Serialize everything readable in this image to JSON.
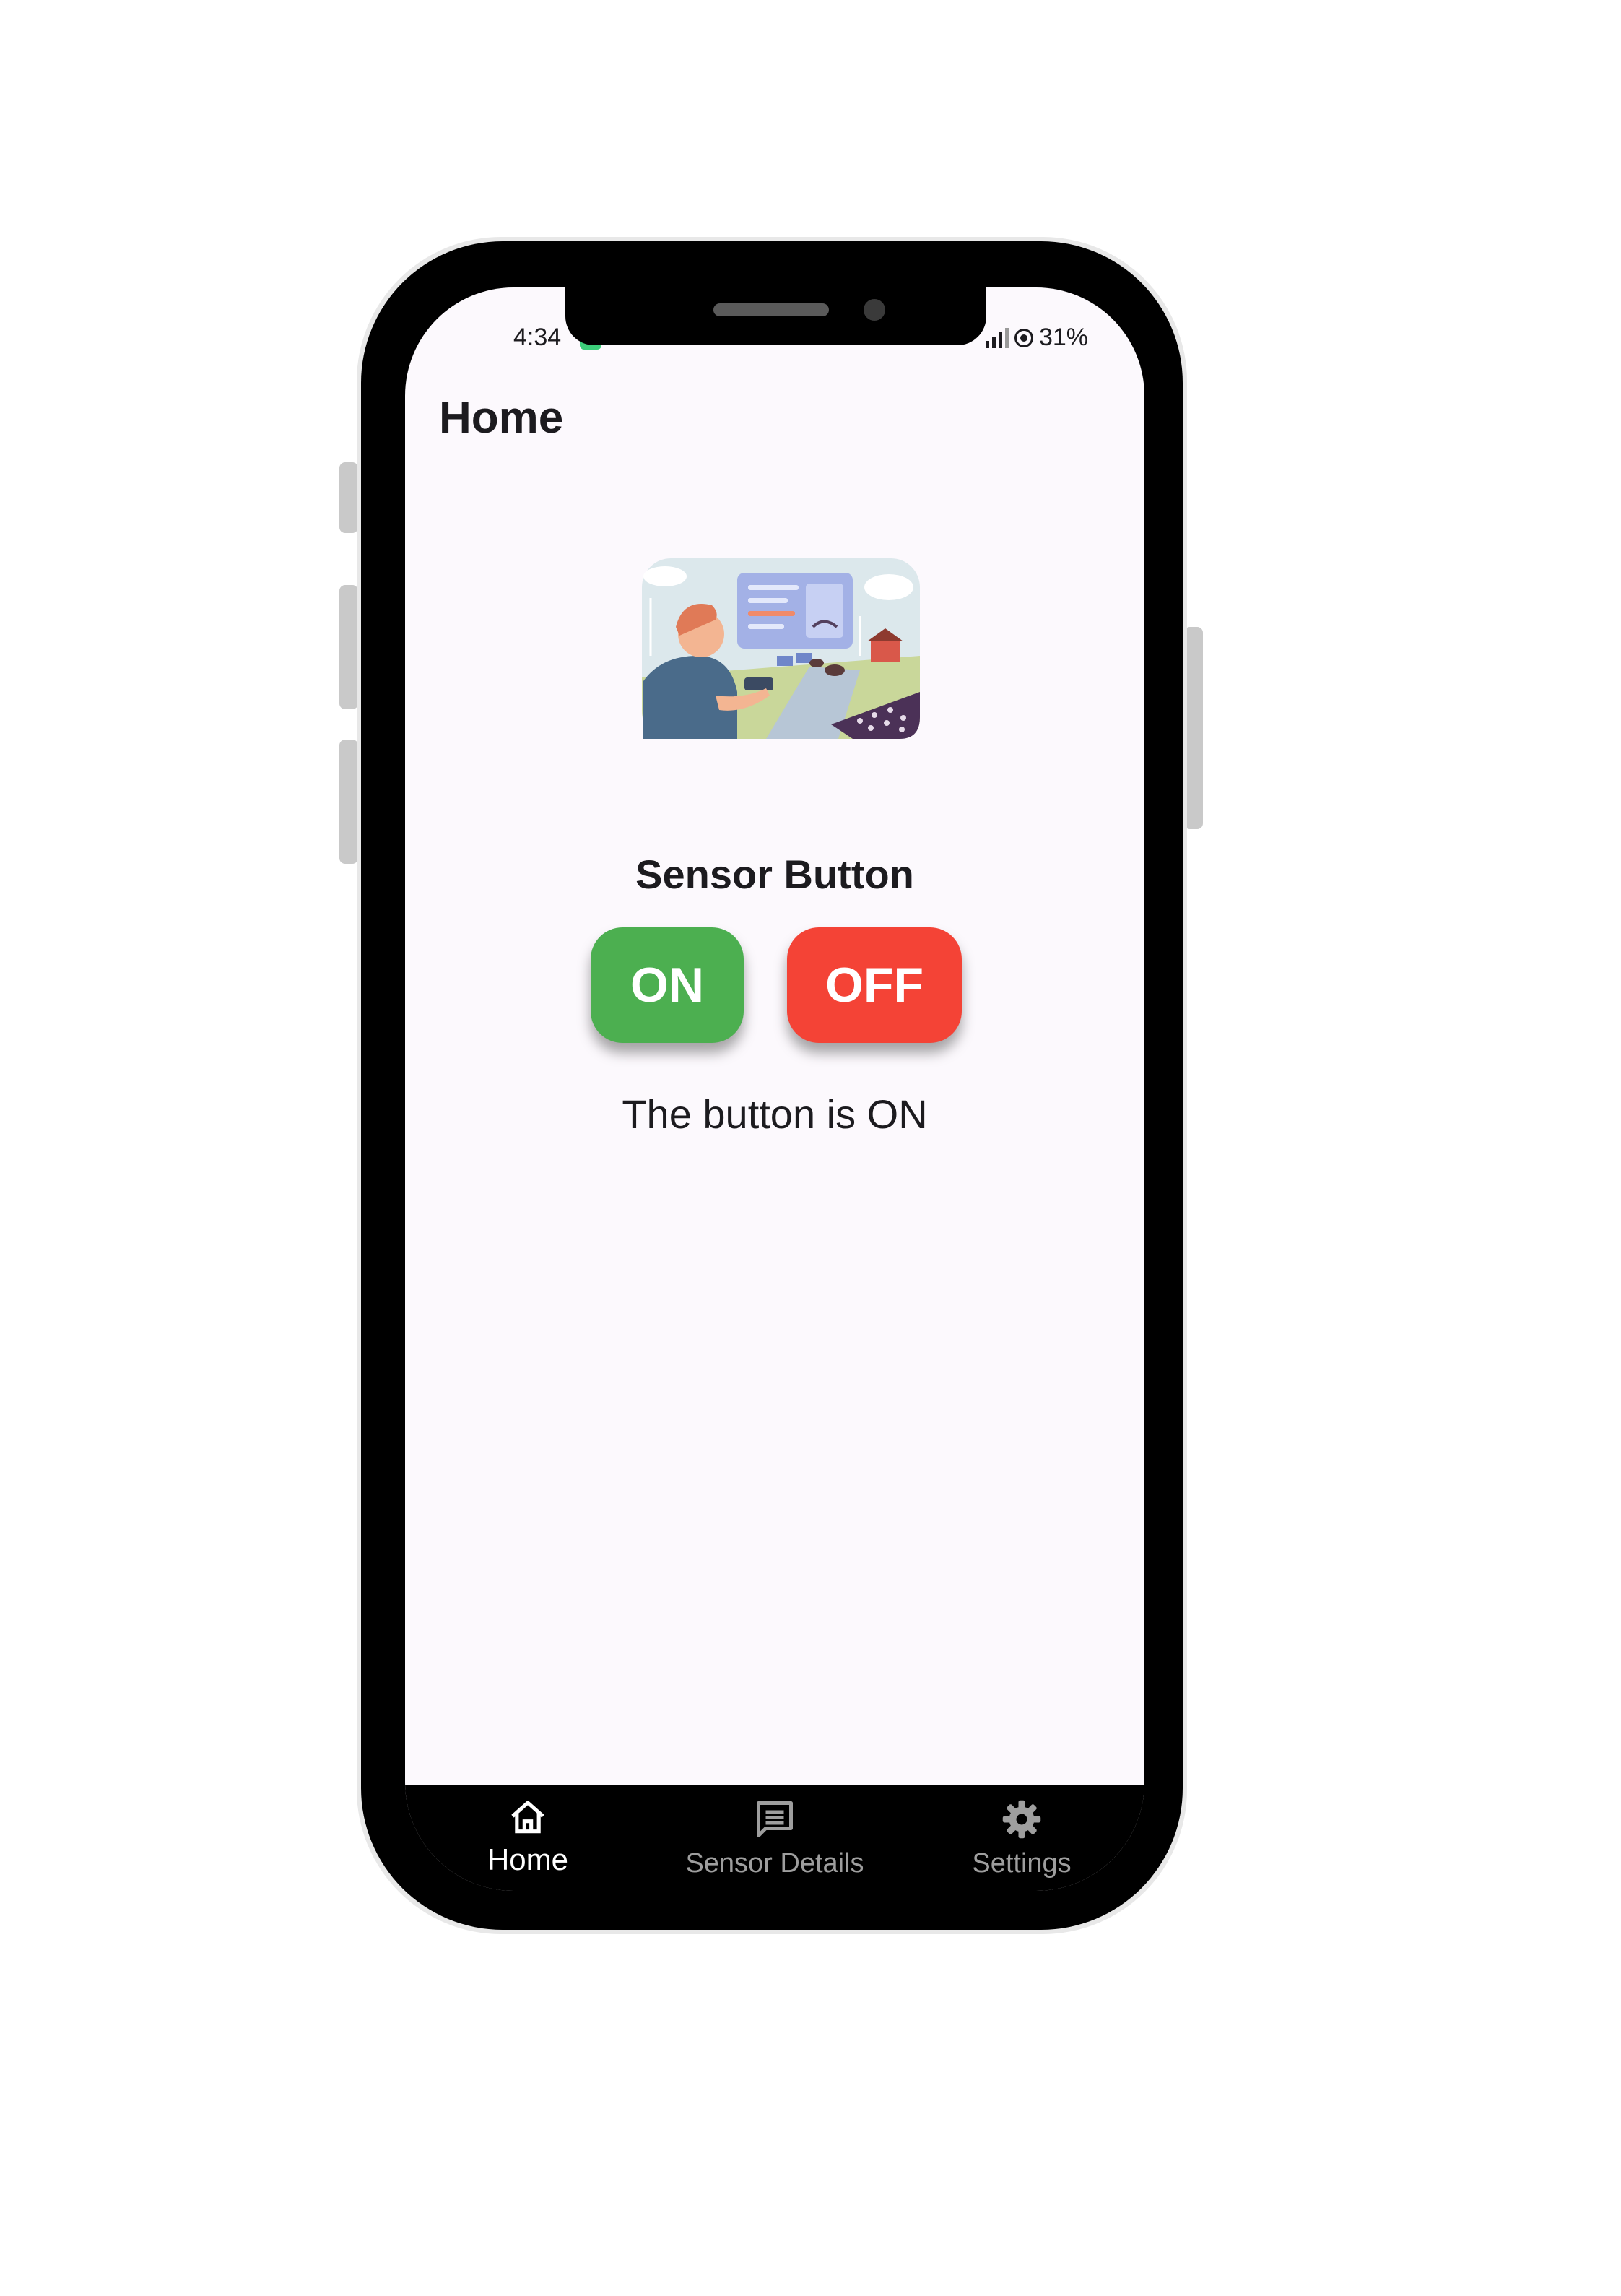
{
  "status_bar": {
    "time": "4:34",
    "battery": "31%"
  },
  "app_bar": {
    "title": "Home"
  },
  "main": {
    "illustration": "farmer-with-smart-farm-dashboard-illustration",
    "section_title": "Sensor Button",
    "on_label": "ON",
    "off_label": "OFF",
    "status_message": "The button is ON"
  },
  "bottom_nav": {
    "items": [
      {
        "label": "Home",
        "icon": "home-icon",
        "active": true
      },
      {
        "label": "Sensor Details",
        "icon": "message-icon",
        "active": false
      },
      {
        "label": "Settings",
        "icon": "gear-icon",
        "active": false
      }
    ]
  },
  "colors": {
    "on_button": "#4caf50",
    "off_button": "#f44336",
    "background": "#fcf9fd",
    "nav_background": "#000000"
  }
}
